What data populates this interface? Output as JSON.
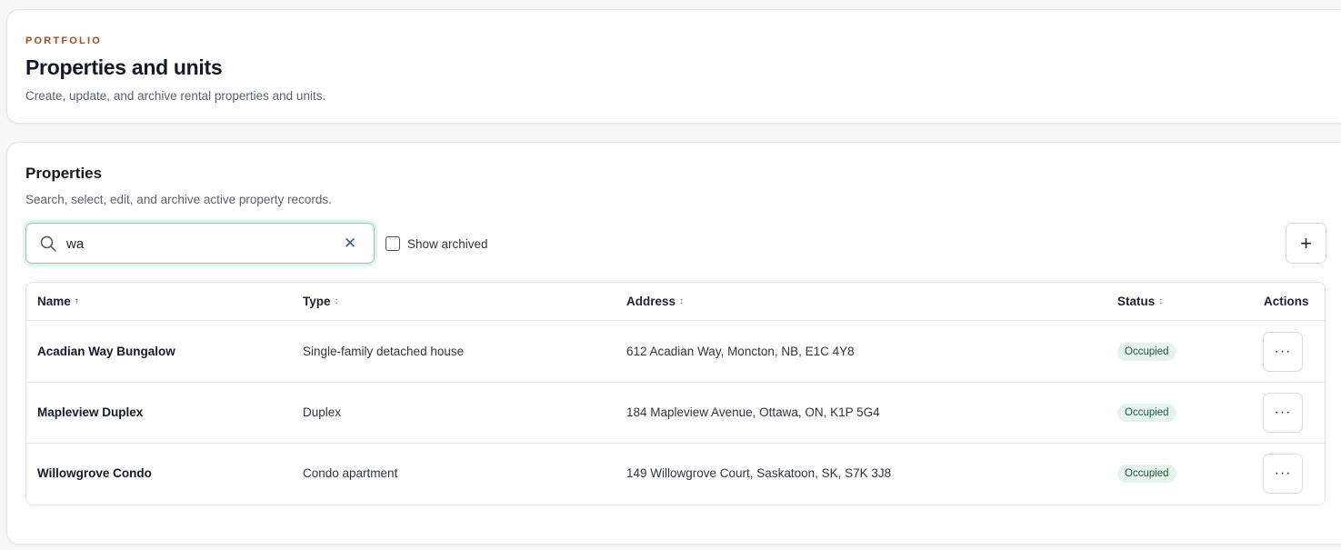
{
  "header": {
    "eyebrow": "PORTFOLIO",
    "title": "Properties and units",
    "subtitle": "Create, update, and archive rental properties and units."
  },
  "properties": {
    "title": "Properties",
    "subtitle": "Search, select, edit, and archive active property records.",
    "search": {
      "value": "wa",
      "icon": "search-icon",
      "clear_icon": "close-icon"
    },
    "show_archived": {
      "label": "Show archived",
      "checked": false
    },
    "add_button": {
      "icon": "plus-icon"
    }
  },
  "table": {
    "columns": [
      {
        "label": "Name",
        "sort": "ascending"
      },
      {
        "label": "Type",
        "sort": "none"
      },
      {
        "label": "Address",
        "sort": "none"
      },
      {
        "label": "Status",
        "sort": "none"
      },
      {
        "label": "Actions"
      }
    ],
    "rows": [
      {
        "name": "Acadian Way Bungalow",
        "type": "Single-family detached house",
        "address": "612 Acadian Way, Moncton, NB, E1C 4Y8",
        "status": "Occupied"
      },
      {
        "name": "Mapleview Duplex",
        "type": "Duplex",
        "address": "184 Mapleview Avenue, Ottawa, ON, K1P 5G4",
        "status": "Occupied"
      },
      {
        "name": "Willowgrove Condo",
        "type": "Condo apartment",
        "address": "149 Willowgrove Court, Saskatoon, SK, S7K 3J8",
        "status": "Occupied"
      }
    ]
  },
  "colors": {
    "accent": "#a24a22",
    "focus_ring": "#8fcdb0",
    "status_bg": "#e6f3ec",
    "status_text": "#1f5a3c"
  }
}
